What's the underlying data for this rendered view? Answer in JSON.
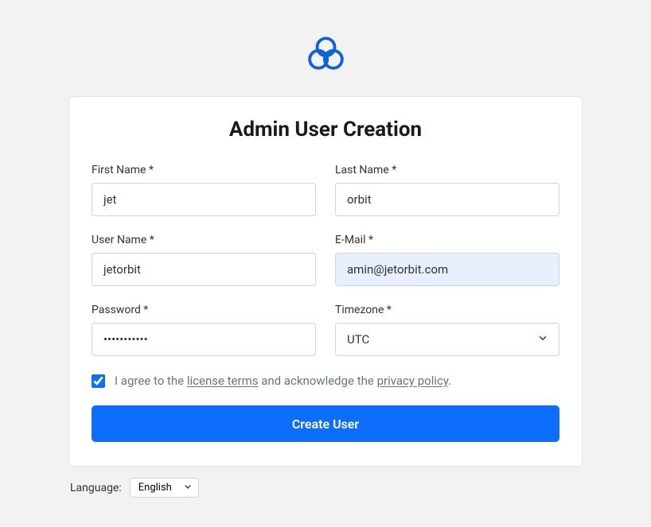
{
  "title": "Admin User Creation",
  "fields": {
    "first_name": {
      "label": "First Name *",
      "value": "jet"
    },
    "last_name": {
      "label": "Last Name *",
      "value": "orbit"
    },
    "user_name": {
      "label": "User Name *",
      "value": "jetorbit"
    },
    "email": {
      "label": "E-Mail *",
      "value": "amin@jetorbit.com"
    },
    "password": {
      "label": "Password *",
      "value": "•••••••••••"
    },
    "timezone": {
      "label": "Timezone *",
      "value": "UTC"
    }
  },
  "agree": {
    "checked": true,
    "text_pre": "I agree to the ",
    "license_terms": "license terms",
    "text_mid": " and acknowledge the ",
    "privacy_policy": "privacy policy",
    "text_post": "."
  },
  "submit_label": "Create User",
  "language": {
    "label": "Language:",
    "value": "English"
  },
  "colors": {
    "primary": "#0d6efd",
    "background": "#f2f2f2",
    "autofill": "#e8f0fe"
  }
}
